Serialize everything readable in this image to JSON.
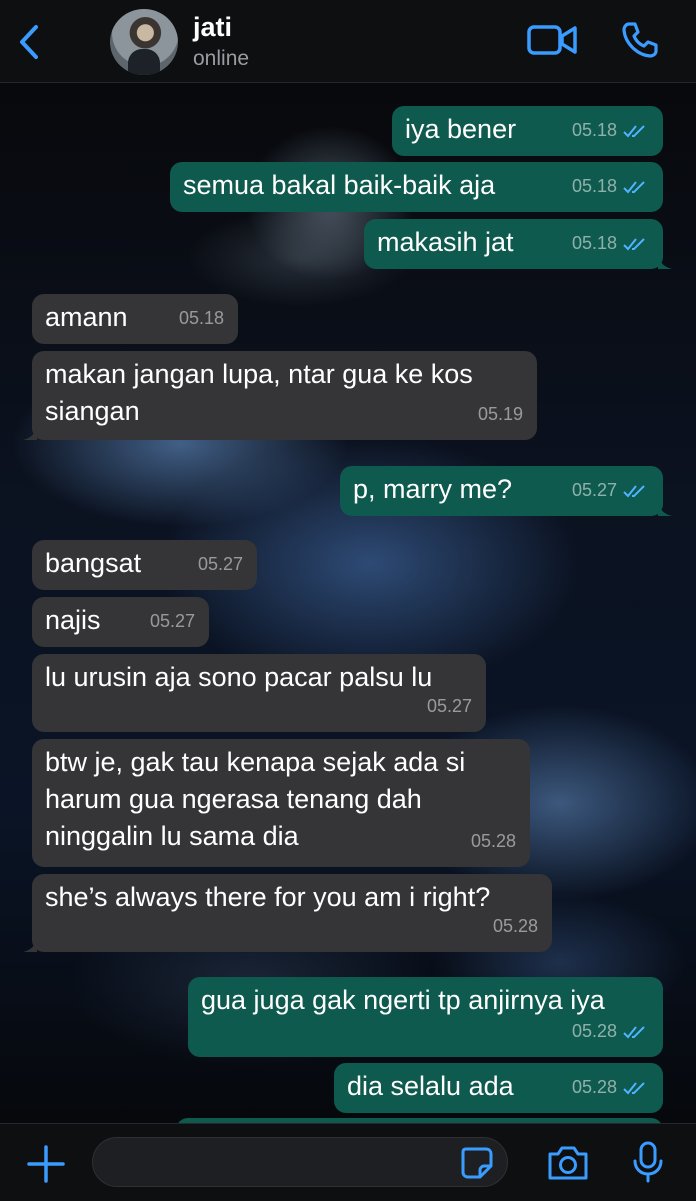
{
  "header": {
    "contact_name": "jati",
    "status": "online"
  },
  "messages": [
    {
      "direction": "out",
      "text": "iya bener",
      "time": "05.18",
      "read": true
    },
    {
      "direction": "out",
      "text": "semua bakal baik-baik aja",
      "time": "05.18",
      "read": true
    },
    {
      "direction": "out",
      "text": "makasih jat",
      "time": "05.18",
      "read": true
    },
    {
      "direction": "in",
      "text": "amann",
      "time": "05.18"
    },
    {
      "direction": "in",
      "text": "makan jangan lupa, ntar gua ke kos\nsiangan",
      "time": "05.19"
    },
    {
      "direction": "out",
      "text": "p, marry me?",
      "time": "05.27",
      "read": true
    },
    {
      "direction": "in",
      "text": "bangsat",
      "time": "05.27"
    },
    {
      "direction": "in",
      "text": "najis",
      "time": "05.27"
    },
    {
      "direction": "in",
      "text": "lu urusin aja sono pacar palsu lu",
      "time": "05.27"
    },
    {
      "direction": "in",
      "text": "btw je, gak tau kenapa sejak ada si\nharum gua ngerasa tenang dah\nninggalin lu sama dia",
      "time": "05.28"
    },
    {
      "direction": "in",
      "text": "she’s always there for you am i right?",
      "time": "05.28"
    },
    {
      "direction": "out",
      "text": "gua juga gak ngerti tp anjirnya iya",
      "time": "05.28",
      "read": true
    },
    {
      "direction": "out",
      "text": "dia selalu ada",
      "time": "05.28",
      "read": true
    }
  ],
  "input": {
    "placeholder": ""
  },
  "colors": {
    "accent": "#3b9cff",
    "outgoing_bubble": "#0f5a4e",
    "incoming_bubble": "#353537",
    "read_ticks": "#4fb3ff"
  },
  "icons": [
    "back-chevron-icon",
    "video-call-icon",
    "phone-icon",
    "plus-icon",
    "sticker-icon",
    "camera-icon",
    "microphone-icon",
    "double-check-icon"
  ]
}
